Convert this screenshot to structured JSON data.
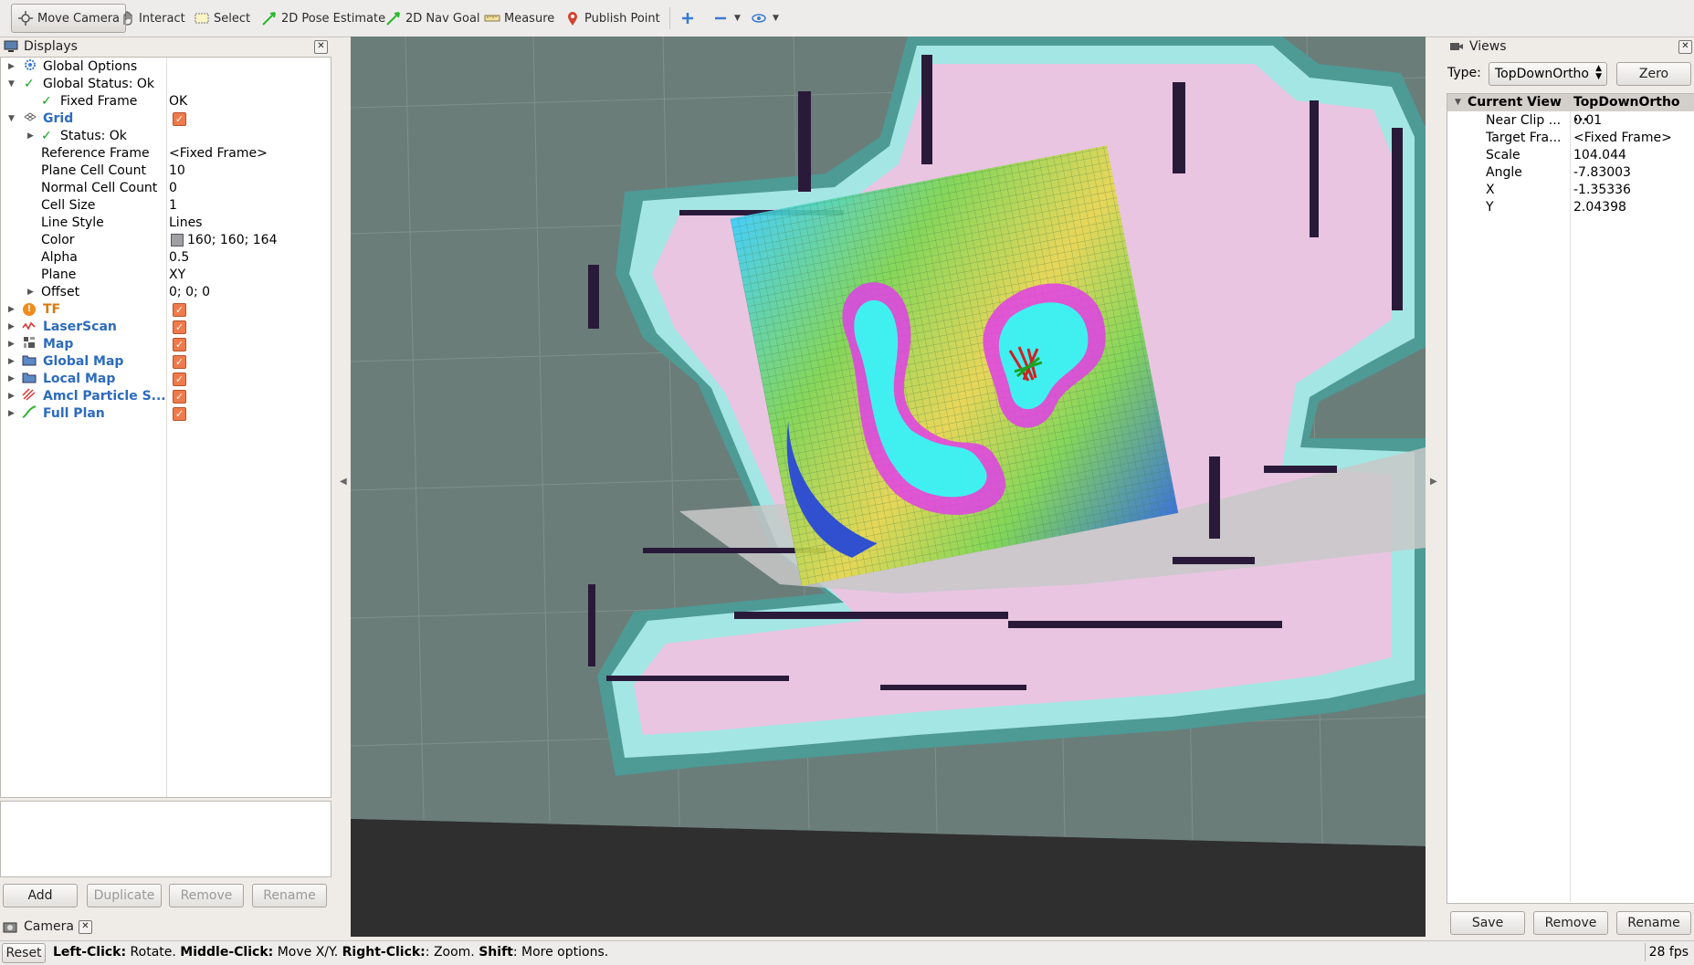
{
  "toolbar": {
    "move_camera": "Move Camera",
    "interact": "Interact",
    "select": "Select",
    "pose_estimate": "2D Pose Estimate",
    "nav_goal": "2D Nav Goal",
    "measure": "Measure",
    "publish_point": "Publish Point"
  },
  "displays": {
    "title": "Displays",
    "items": [
      {
        "label": "Global Options"
      },
      {
        "label": "Global Status: Ok"
      },
      {
        "label": "Fixed Frame",
        "value": "OK"
      },
      {
        "label": "Grid"
      },
      {
        "label": "Status: Ok"
      },
      {
        "label": "Reference Frame",
        "value": "<Fixed Frame>"
      },
      {
        "label": "Plane Cell Count",
        "value": "10"
      },
      {
        "label": "Normal Cell Count",
        "value": "0"
      },
      {
        "label": "Cell Size",
        "value": "1"
      },
      {
        "label": "Line Style",
        "value": "Lines"
      },
      {
        "label": "Color",
        "value": "160; 160; 164"
      },
      {
        "label": "Alpha",
        "value": "0.5"
      },
      {
        "label": "Plane",
        "value": "XY"
      },
      {
        "label": "Offset",
        "value": "0; 0; 0"
      },
      {
        "label": "TF"
      },
      {
        "label": "LaserScan"
      },
      {
        "label": "Map"
      },
      {
        "label": "Global Map"
      },
      {
        "label": "Local Map"
      },
      {
        "label": "Amcl Particle S..."
      },
      {
        "label": "Full Plan"
      }
    ],
    "buttons": {
      "add": "Add",
      "duplicate": "Duplicate",
      "remove": "Remove",
      "rename": "Rename"
    }
  },
  "camera_panel": {
    "title": "Camera"
  },
  "views": {
    "title": "Views",
    "type_label": "Type:",
    "type_value": "TopDownOrtho",
    "zero": "Zero",
    "header": {
      "name": "Current View",
      "value": "TopDownOrtho ..."
    },
    "props": [
      {
        "label": "Near Clip ...",
        "value": "0.01"
      },
      {
        "label": "Target Fra...",
        "value": "<Fixed Frame>"
      },
      {
        "label": "Scale",
        "value": "104.044"
      },
      {
        "label": "Angle",
        "value": "-7.83003"
      },
      {
        "label": "X",
        "value": "-1.35336"
      },
      {
        "label": "Y",
        "value": "2.04398"
      }
    ],
    "buttons": {
      "save": "Save",
      "remove": "Remove",
      "rename": "Rename"
    }
  },
  "status": {
    "reset": "Reset",
    "left_click": "Left-Click:",
    "left_desc": " Rotate. ",
    "middle_click": "Middle-Click:",
    "middle_desc": " Move X/Y. ",
    "right_click": "Right-Click:",
    "right_desc": ": Zoom. ",
    "shift": "Shift",
    "shift_desc": ": More options.",
    "fps": "28 fps"
  }
}
